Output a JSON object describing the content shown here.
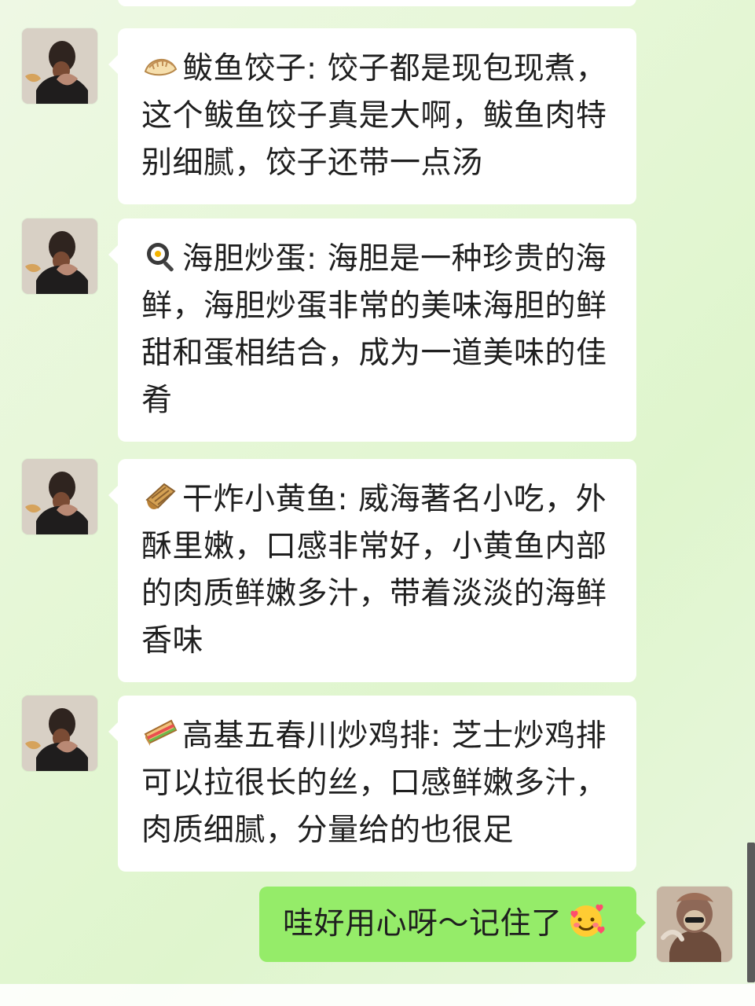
{
  "messages": [
    {
      "emoji_icon": "dumpling-icon",
      "title": "鲅鱼饺子",
      "separator": ":",
      "body": "饺子都是现包现煮，这个鲅鱼饺子真是大啊，鲅鱼肉特别细腻，饺子还带一点汤",
      "sender": "contact"
    },
    {
      "emoji_icon": "frying-pan-egg-icon",
      "title": "海胆炒蛋",
      "separator": ":",
      "body": "海胆是一种珍贵的海鲜，海胆炒蛋非常的美味海胆的鲜甜和蛋相结合，成为一道美味的佳肴",
      "sender": "contact"
    },
    {
      "emoji_icon": "rolled-fish-icon",
      "title": "干炸小黄鱼",
      "separator": ":",
      "body": "威海著名小吃，外酥里嫩，口感非常好，小黄鱼内部的肉质鲜嫩多汁，带着淡淡的海鲜香味",
      "sender": "contact"
    },
    {
      "emoji_icon": "sandwich-icon",
      "title": "高基五春川炒鸡排",
      "separator": ":",
      "body": "芝士炒鸡排可以拉很长的丝，口感鲜嫩多汁，肉质细腻，分量给的也很足",
      "sender": "contact"
    }
  ],
  "reply": {
    "text": "哇好用心呀～记住了",
    "emoji_icon": "smiling-face-with-hearts-icon",
    "sender": "self"
  },
  "colors": {
    "background": "#e6f7d7",
    "incoming_bubble": "#ffffff",
    "outgoing_bubble": "#95ec69",
    "text": "#1f1f1f"
  }
}
